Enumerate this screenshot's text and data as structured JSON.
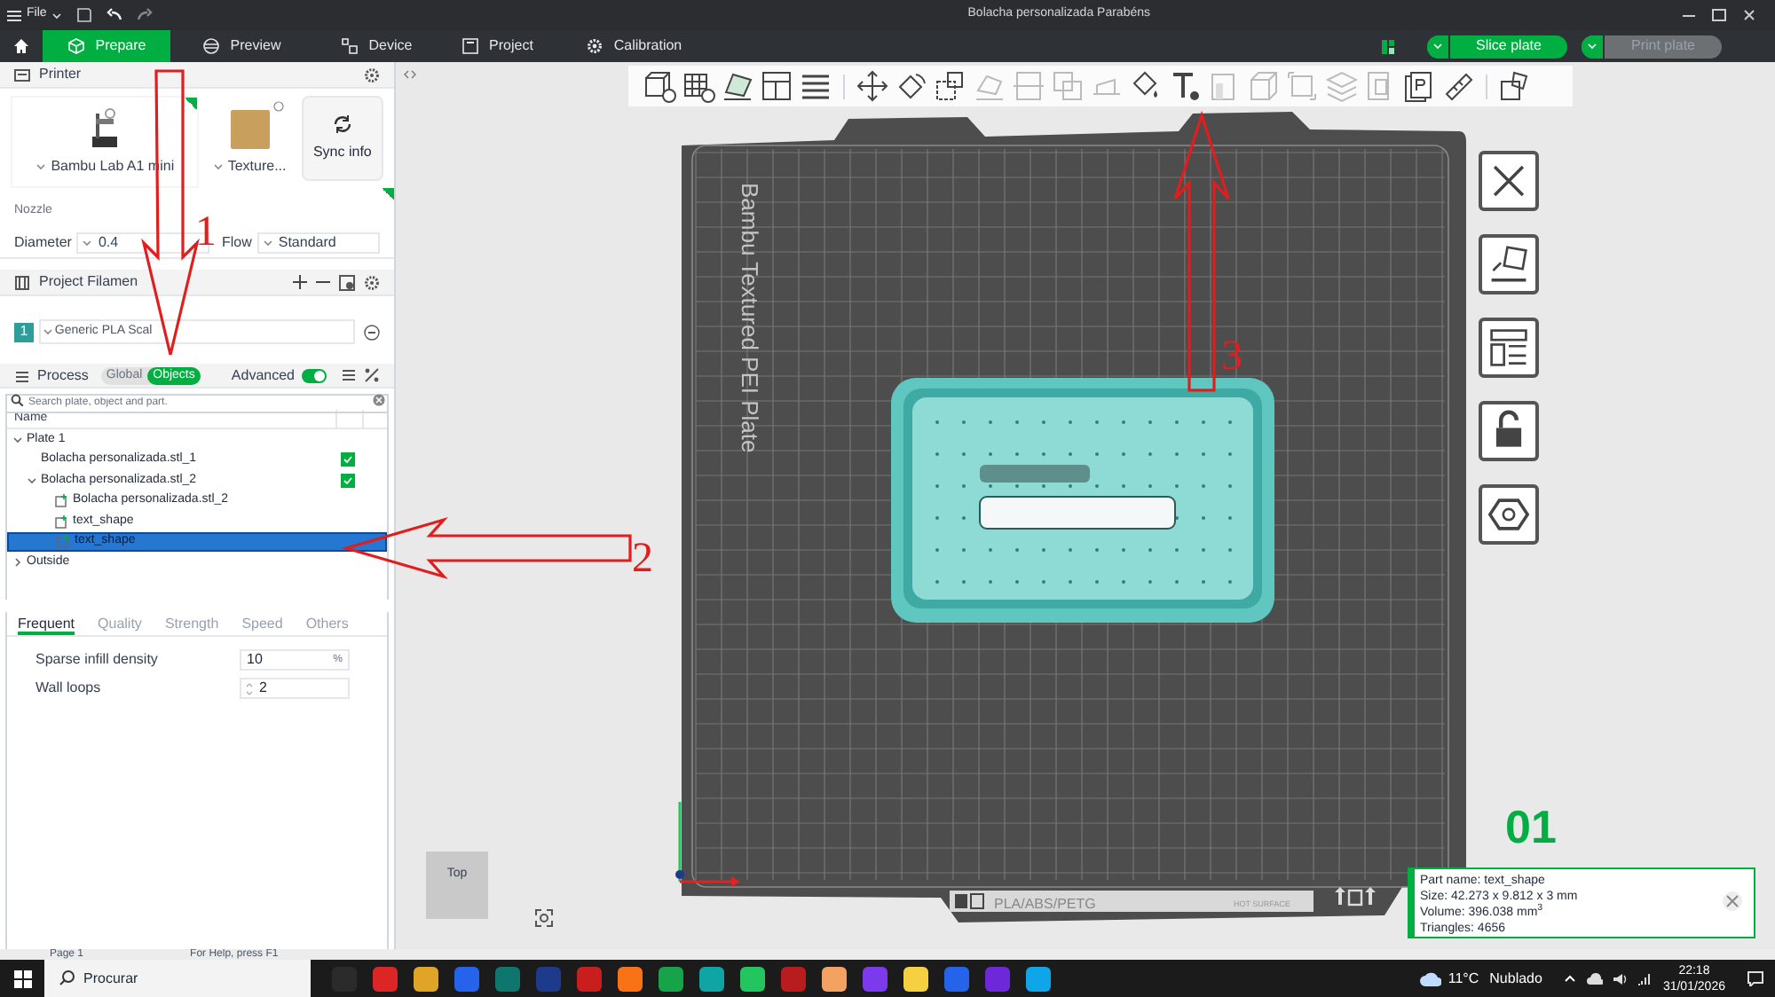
{
  "window": {
    "title": "Bolacha personalizada Parabéns",
    "menu": "File"
  },
  "tabs": [
    {
      "label": "Prepare",
      "selected": true
    },
    {
      "label": "Preview",
      "selected": false
    },
    {
      "label": "Device",
      "selected": false
    },
    {
      "label": "Project",
      "selected": false
    },
    {
      "label": "Calibration",
      "selected": false
    }
  ],
  "actions": [
    {
      "label": "Slice plate",
      "disabled": false
    },
    {
      "label": "Print plate",
      "disabled": true
    }
  ],
  "printer": {
    "title": "Printer",
    "model": "Bambu Lab A1 mini",
    "plate": "Texture...",
    "sync": "Sync info",
    "nozzle_label": "Nozzle",
    "diameter_label": "Diameter",
    "diameter": "0.4",
    "flow_label": "Flow",
    "flow": "Standard"
  },
  "filament": {
    "title": "Project Filamen",
    "items": [
      {
        "index": "1",
        "name": "Generic PLA Scal",
        "color": "#2f9e9a"
      }
    ]
  },
  "process": {
    "title": "Process",
    "modes": [
      {
        "label": "Global",
        "selected": false
      },
      {
        "label": "Objects",
        "selected": true
      }
    ],
    "advanced_label": "Advanced",
    "advanced": true,
    "search_placeholder": "Search plate, object and part."
  },
  "tree": {
    "column": "Name",
    "items": [
      {
        "label": "Plate 1",
        "expanded": true,
        "selected": false,
        "children": [
          {
            "label": "Bolacha personalizada.stl_1",
            "kind": "object",
            "checked": true,
            "selected": false
          },
          {
            "label": "Bolacha personalizada.stl_2",
            "kind": "object",
            "expanded": true,
            "checked": true,
            "selected": false,
            "children": [
              {
                "label": "Bolacha personalizada.stl_2",
                "kind": "part",
                "selected": false
              },
              {
                "label": "text_shape",
                "kind": "part",
                "selected": false
              },
              {
                "label": "text_shape",
                "kind": "part",
                "selected": true
              }
            ]
          }
        ]
      },
      {
        "label": "Outside",
        "expanded": false,
        "selected": false
      }
    ]
  },
  "settings_tabs": [
    {
      "label": "Frequent",
      "selected": true
    },
    {
      "label": "Quality",
      "selected": false
    },
    {
      "label": "Strength",
      "selected": false
    },
    {
      "label": "Speed",
      "selected": false
    },
    {
      "label": "Others",
      "selected": false
    }
  ],
  "settings": [
    {
      "label": "Sparse infill density",
      "value": "10",
      "unit": "%",
      "kind": "unit"
    },
    {
      "label": "Wall loops",
      "value": "2",
      "kind": "spin"
    }
  ],
  "status_bar": {
    "page": "Page 1",
    "help": "For Help, press F1"
  },
  "plate": {
    "name": "Bambu Textured PEI Plate",
    "number": "01",
    "material": "PLA/ABS/PETG",
    "warning": "HOT SURFACE"
  },
  "part_info": [
    "Part name: text_shape",
    "Size: 42.273 x 9.812 x 3 mm",
    "Volume: 396.038 mm$^{3}$",
    "Triangles: 4656"
  ],
  "view_cube": "Top",
  "annotations": [
    "1",
    "2",
    "3"
  ],
  "taskbar": {
    "search": "Procurar",
    "temperature": "11°C",
    "condition": "Nublado",
    "time": "22:18",
    "date": "31/01/2026"
  }
}
